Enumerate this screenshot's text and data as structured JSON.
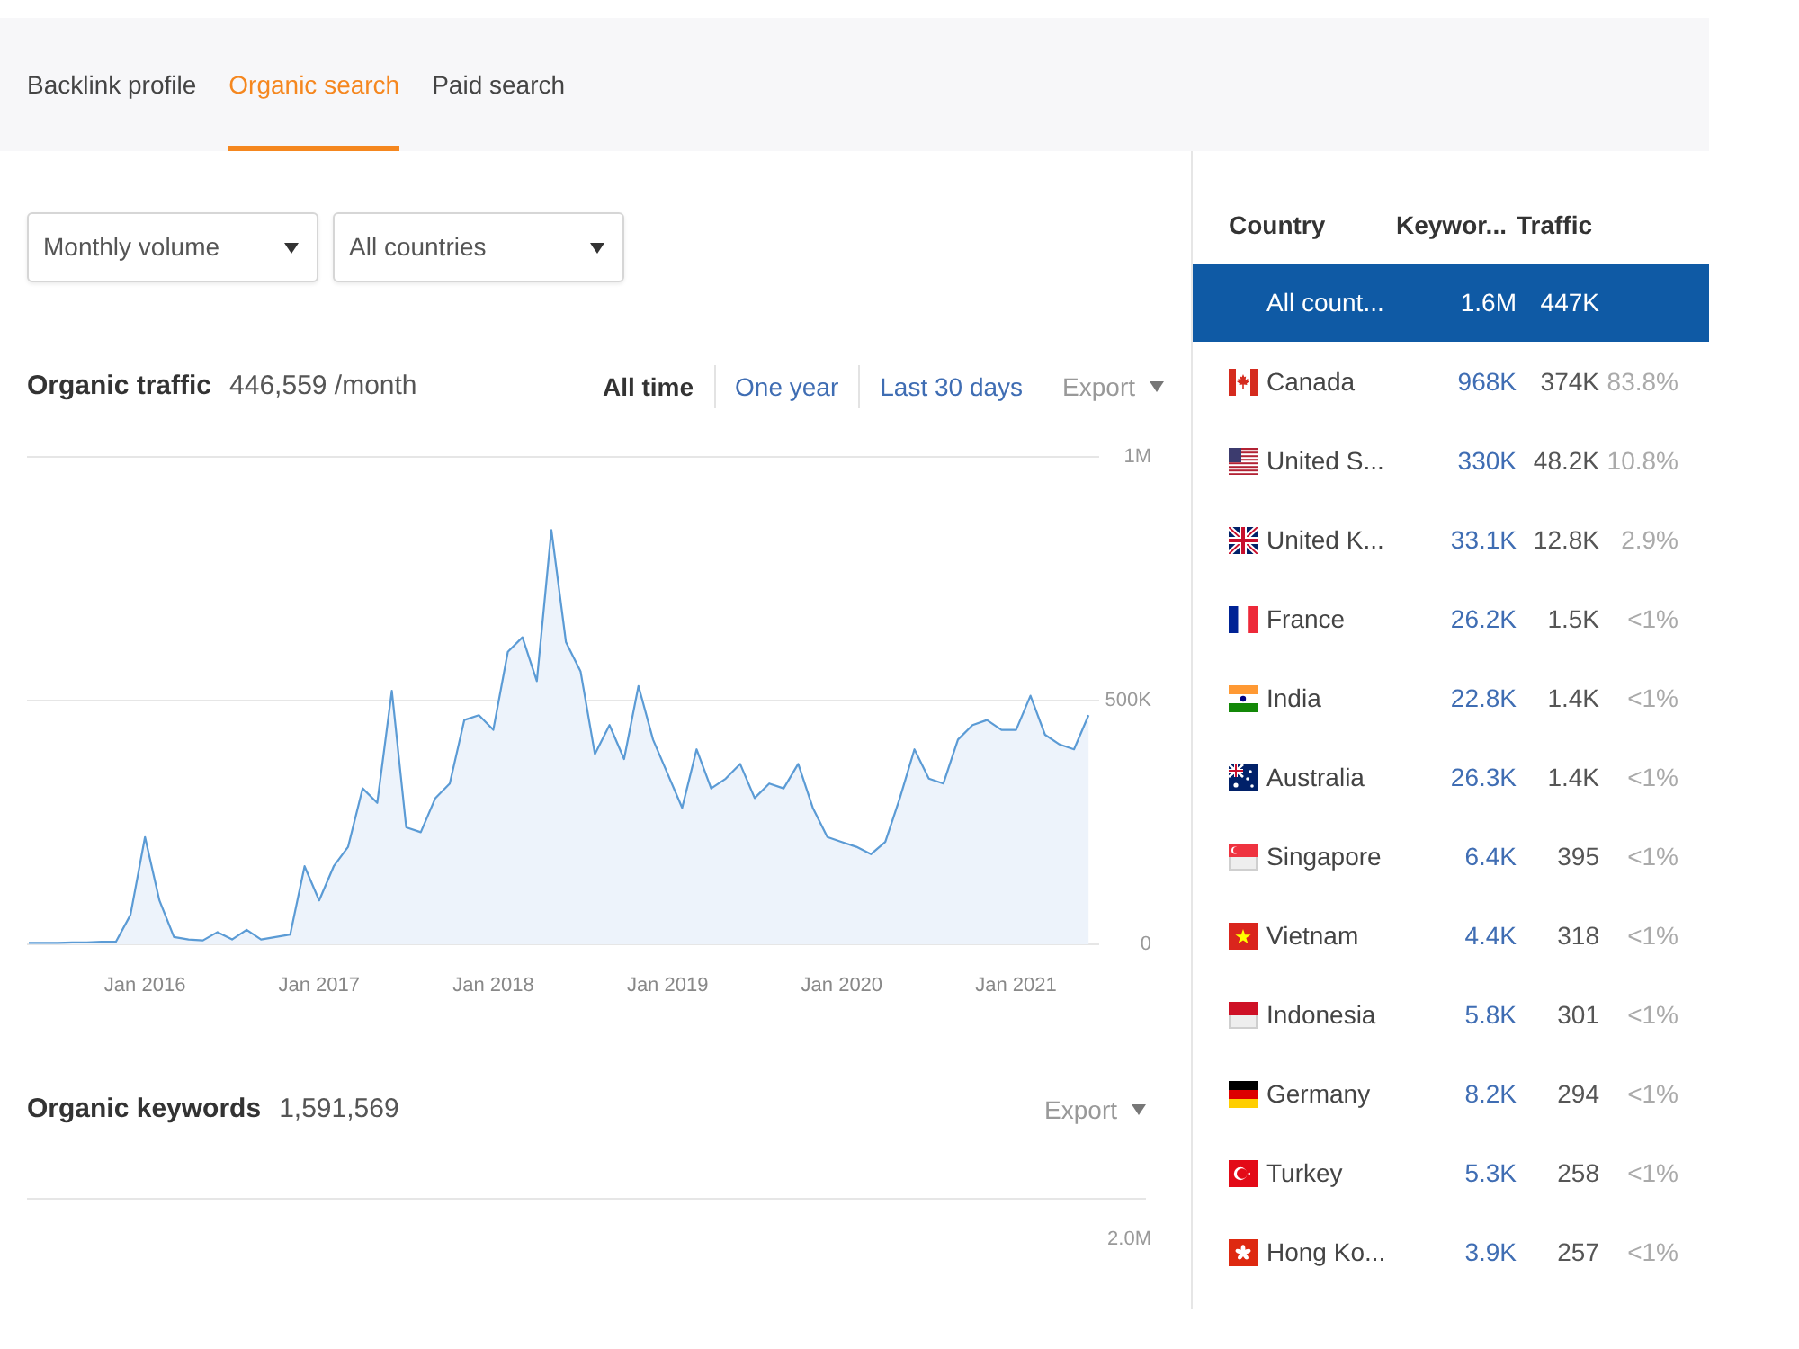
{
  "tabs": [
    {
      "label": "Backlink profile",
      "selected": false
    },
    {
      "label": "Organic search",
      "selected": true
    },
    {
      "label": "Paid search",
      "selected": false
    }
  ],
  "filters": [
    {
      "value": "Monthly volume"
    },
    {
      "value": "All countries"
    }
  ],
  "organic_traffic": {
    "title": "Organic traffic",
    "value": "446,559 /month",
    "ranges": [
      {
        "label": "All time",
        "selected": true
      },
      {
        "label": "One year",
        "selected": false
      },
      {
        "label": "Last 30 days",
        "selected": false
      }
    ],
    "export": "Export",
    "chart_data": {
      "type": "area",
      "ylim": [
        0,
        1000000
      ],
      "yticks": [
        {
          "value": 0,
          "label": "0"
        },
        {
          "value": 500000,
          "label": "500K"
        },
        {
          "value": 1000000,
          "label": "1M"
        }
      ],
      "categories": [
        null,
        null,
        null,
        null,
        null,
        null,
        null,
        null,
        "Jan 2016",
        null,
        null,
        null,
        null,
        null,
        null,
        null,
        null,
        null,
        null,
        null,
        "Jan 2017",
        null,
        null,
        null,
        null,
        null,
        null,
        null,
        null,
        null,
        null,
        null,
        "Jan 2018",
        null,
        null,
        null,
        null,
        null,
        null,
        null,
        null,
        null,
        null,
        null,
        "Jan 2019",
        null,
        null,
        null,
        null,
        null,
        null,
        null,
        null,
        null,
        null,
        null,
        "Jan 2020",
        null,
        null,
        null,
        null,
        null,
        null,
        null,
        null,
        null,
        null,
        null,
        "Jan 2021",
        null,
        null,
        null,
        null,
        null
      ],
      "series": [
        {
          "color": "#5b9bd5",
          "values": [
            3000,
            3000,
            3000,
            4000,
            4000,
            5000,
            5000,
            60000,
            220000,
            90000,
            15000,
            10000,
            8000,
            25000,
            10000,
            30000,
            10000,
            15000,
            20000,
            160000,
            90000,
            160000,
            200000,
            320000,
            290000,
            520000,
            240000,
            230000,
            300000,
            330000,
            460000,
            470000,
            440000,
            600000,
            630000,
            540000,
            850000,
            620000,
            560000,
            390000,
            450000,
            380000,
            530000,
            420000,
            350000,
            280000,
            400000,
            320000,
            340000,
            370000,
            300000,
            330000,
            320000,
            370000,
            280000,
            220000,
            210000,
            200000,
            185000,
            210000,
            300000,
            400000,
            340000,
            330000,
            420000,
            450000,
            460000,
            440000,
            440000,
            510000,
            430000,
            410000,
            400000,
            470000
          ]
        }
      ]
    }
  },
  "organic_keywords": {
    "title": "Organic keywords",
    "value": "1,591,569",
    "export": "Export",
    "axis_label": "2.0M"
  },
  "countries": {
    "columns": [
      "Country",
      "Keywor...",
      "Traffic"
    ],
    "rows": [
      {
        "kind": "total",
        "name": "All count...",
        "keywords": "1.6M",
        "traffic": "447K",
        "selected": true
      },
      {
        "kind": "canada",
        "name": "Canada",
        "keywords": "968K",
        "traffic": "374K",
        "share": "83.8%",
        "selected": false
      },
      {
        "kind": "usa",
        "name": "United S...",
        "keywords": "330K",
        "traffic": "48.2K",
        "share": "10.8%",
        "selected": false
      },
      {
        "kind": "uk",
        "name": "United K...",
        "keywords": "33.1K",
        "traffic": "12.8K",
        "share": "2.9%",
        "selected": false
      },
      {
        "kind": "france",
        "name": "France",
        "keywords": "26.2K",
        "traffic": "1.5K",
        "share": "<1%",
        "selected": false
      },
      {
        "kind": "india",
        "name": "India",
        "keywords": "22.8K",
        "traffic": "1.4K",
        "share": "<1%",
        "selected": false
      },
      {
        "kind": "australia",
        "name": "Australia",
        "keywords": "26.3K",
        "traffic": "1.4K",
        "share": "<1%",
        "selected": false
      },
      {
        "kind": "singapore",
        "name": "Singapore",
        "keywords": "6.4K",
        "traffic": "395",
        "share": "<1%",
        "selected": false
      },
      {
        "kind": "vietnam",
        "name": "Vietnam",
        "keywords": "4.4K",
        "traffic": "318",
        "share": "<1%",
        "selected": false
      },
      {
        "kind": "indonesia",
        "name": "Indonesia",
        "keywords": "5.8K",
        "traffic": "301",
        "share": "<1%",
        "selected": false
      },
      {
        "kind": "germany",
        "name": "Germany",
        "keywords": "8.2K",
        "traffic": "294",
        "share": "<1%",
        "selected": false
      },
      {
        "kind": "turkey",
        "name": "Turkey",
        "keywords": "5.3K",
        "traffic": "258",
        "share": "<1%",
        "selected": false
      },
      {
        "kind": "hongkong",
        "name": "Hong Ko...",
        "keywords": "3.9K",
        "traffic": "257",
        "share": "<1%",
        "selected": false
      }
    ]
  }
}
